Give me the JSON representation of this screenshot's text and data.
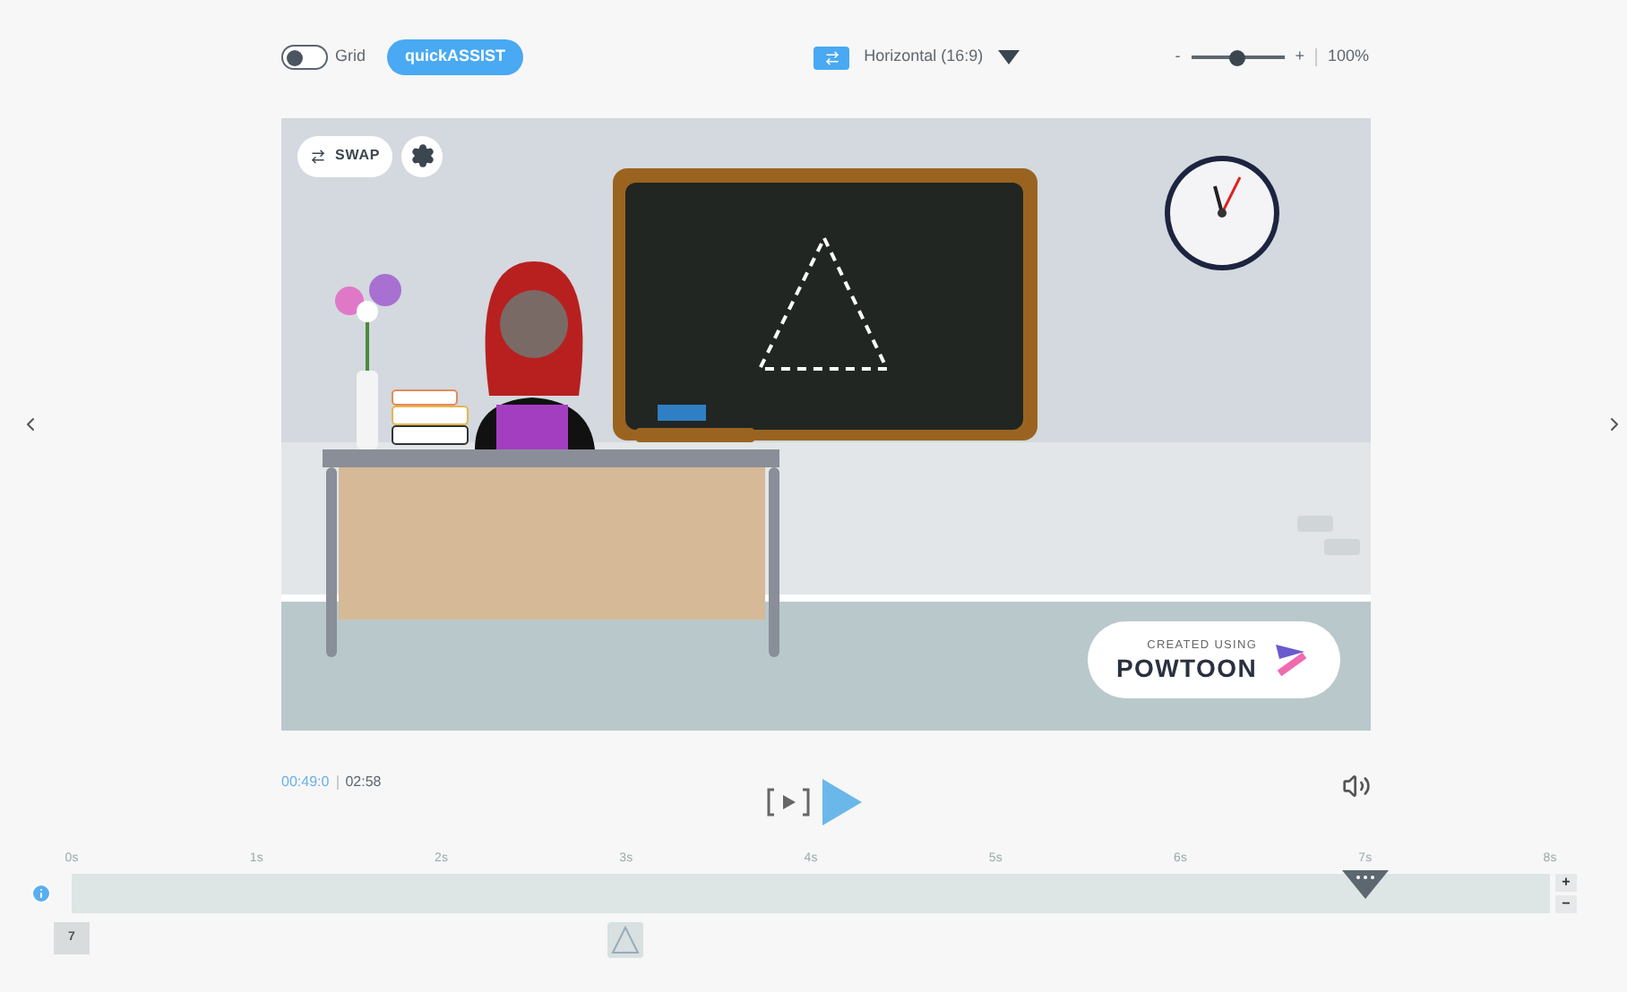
{
  "toolbar": {
    "grid_toggle": {
      "label": "Grid",
      "on": false
    },
    "quick_assist": {
      "label": "quickASSIST"
    },
    "aspect": {
      "label": "Horizontal (16:9)"
    },
    "zoom": {
      "minus": "-",
      "plus": "+",
      "level": 0.5,
      "reading": "100%"
    }
  },
  "stage": {
    "swap": {
      "label": "SWAP"
    },
    "badge": {
      "line_1": "CREATED USING",
      "line_2": "POWTOON"
    }
  },
  "playback": {
    "current_time": "00:49:0",
    "total_time": "02:58"
  },
  "timeline": {
    "ticks": [
      "0s",
      "1s",
      "2s",
      "3s",
      "4s",
      "5s",
      "6s",
      "7s",
      "8s"
    ],
    "playhead": {
      "level": 0.875
    },
    "zoom_in": "+",
    "zoom_out": "−",
    "thumbnails": [
      {
        "kind": "number",
        "label": "7"
      },
      {
        "kind": "shape"
      }
    ]
  }
}
